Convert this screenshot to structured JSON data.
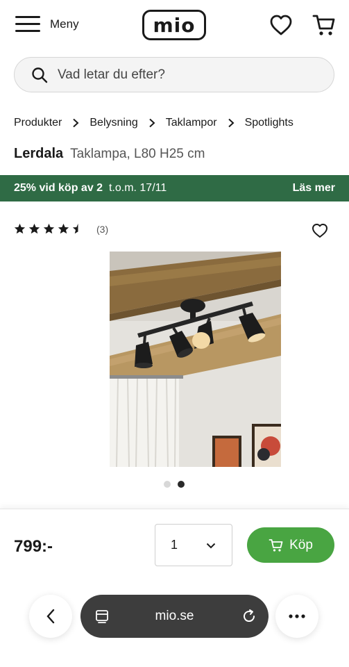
{
  "header": {
    "menu_label": "Meny",
    "logo_text": "mio",
    "icons": [
      "hamburger-icon",
      "heart-icon",
      "cart-icon"
    ]
  },
  "search": {
    "placeholder": "Vad letar du efter?"
  },
  "breadcrumb": [
    "Produkter",
    "Belysning",
    "Taklampor",
    "Spotlights"
  ],
  "product": {
    "brand": "Lerdala",
    "description": "Taklampa, L80 H25 cm",
    "rating_stars": 4.5,
    "rating_count": "(3)",
    "price": "799:-",
    "image_count": 2,
    "active_image": 2
  },
  "promo": {
    "main": "25% vid köp av 2",
    "period": "t.o.m. 17/11",
    "link": "Läs mer",
    "color": "#2f6b45"
  },
  "purchase": {
    "quantity": "1",
    "buy_label": "Köp",
    "buy_color": "#49a542"
  },
  "browser": {
    "url": "mio.se"
  }
}
